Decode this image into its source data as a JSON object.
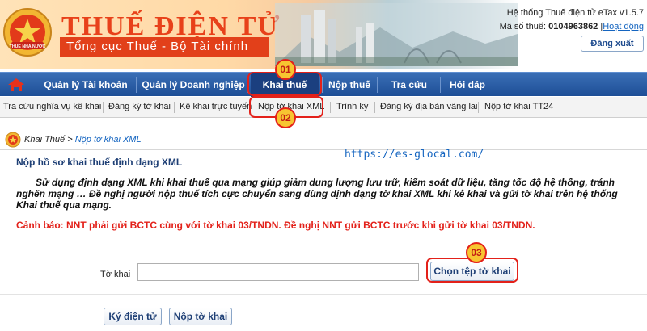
{
  "header": {
    "title": "THUẾ ĐIỆN TỬ",
    "subtitle": "Tổng cục Thuế - Bộ Tài chính",
    "emblem_text": "THUẾ NHÀ NƯỚC",
    "system_label": "Hệ thống Thuế điện tử eTax v1.5.7",
    "tax_id_label": "Mã số thuế:",
    "tax_id_value": "0104963862",
    "status_link": "Hoạt động",
    "logout_label": "Đăng xuất"
  },
  "main_nav": {
    "items": [
      {
        "label": "Quản lý Tài khoản"
      },
      {
        "label": "Quản lý Doanh nghiệp"
      },
      {
        "label": "Khai thuế"
      },
      {
        "label": "Nộp thuế"
      },
      {
        "label": "Tra cứu"
      },
      {
        "label": "Hỏi đáp"
      }
    ],
    "active_index": 2
  },
  "sub_nav": {
    "items": [
      {
        "label": "Tra cứu nghĩa vụ kê khai"
      },
      {
        "label": "Đăng ký tờ khai"
      },
      {
        "label": "Kê khai trực tuyến"
      },
      {
        "label": "Nộp tờ khai XML"
      },
      {
        "label": "Trình ký"
      },
      {
        "label": "Đăng ký địa bàn vãng lai"
      },
      {
        "label": "Nộp tờ khai TT24"
      }
    ],
    "active_index": 3
  },
  "breadcrumb": {
    "root": "Khai Thuế",
    "separator": ">",
    "current": "Nộp tờ khai XML"
  },
  "content": {
    "title": "Nộp hồ sơ khai thuế định dạng XML",
    "description": "Sử dụng định dạng XML khi khai thuế qua mạng giúp giảm dung lượng lưu trữ, kiểm soát dữ liệu, tăng tốc độ hệ thống, tránh nghẽn mạng … Đề nghị người nộp thuế tích cực chuyển sang dùng định dạng tờ khai XML khi kê khai và gửi tờ khai trên hệ thống Khai thuế qua mạng.",
    "warning": "Cảnh báo: NNT phải gửi BCTC cùng với tờ khai 03/TNDN. Đề nghị NNT gửi BCTC trước khi gửi tờ khai 03/TNDN.",
    "watermark_url": "https://es-glocal.com/"
  },
  "form": {
    "file_label": "Tờ khai",
    "file_value": "",
    "choose_button": "Chọn tệp tờ khai",
    "sign_button": "Ký điện tử",
    "submit_button": "Nộp tờ khai"
  },
  "callouts": [
    "01",
    "02",
    "03"
  ],
  "colors": {
    "brand_red": "#e2401a",
    "nav_blue": "#1e4e96",
    "link_blue": "#1565c0",
    "warning_red": "#e3211a",
    "callout_yellow": "#f7c531"
  }
}
